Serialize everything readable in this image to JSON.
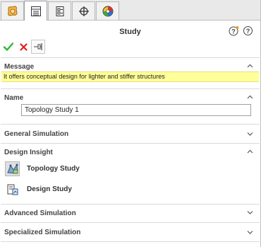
{
  "panel": {
    "title": "Study"
  },
  "tabs": [
    {
      "icon": "feature-manager-icon"
    },
    {
      "icon": "property-manager-icon"
    },
    {
      "icon": "configuration-manager-icon"
    },
    {
      "icon": "dimxpert-icon"
    },
    {
      "icon": "display-manager-icon"
    }
  ],
  "actions": {
    "ok_icon": "check-icon",
    "cancel_icon": "close-icon",
    "pin_icon": "pushpin-icon"
  },
  "sections": {
    "message": {
      "label": "Message",
      "text": "It offers conceptual design for lighter and stiffer structures"
    },
    "name": {
      "label": "Name",
      "value": "Topology Study 1"
    },
    "general": {
      "label": "General Simulation"
    },
    "insight": {
      "label": "Design Insight",
      "items": [
        {
          "label": "Topology Study"
        },
        {
          "label": "Design Study"
        }
      ]
    },
    "advanced": {
      "label": "Advanced Simulation"
    },
    "specialized": {
      "label": "Specialized Simulation"
    }
  },
  "colors": {
    "message_bg": "#ffff99",
    "ok_green": "#2eb82e",
    "cancel_red": "#e02020"
  }
}
